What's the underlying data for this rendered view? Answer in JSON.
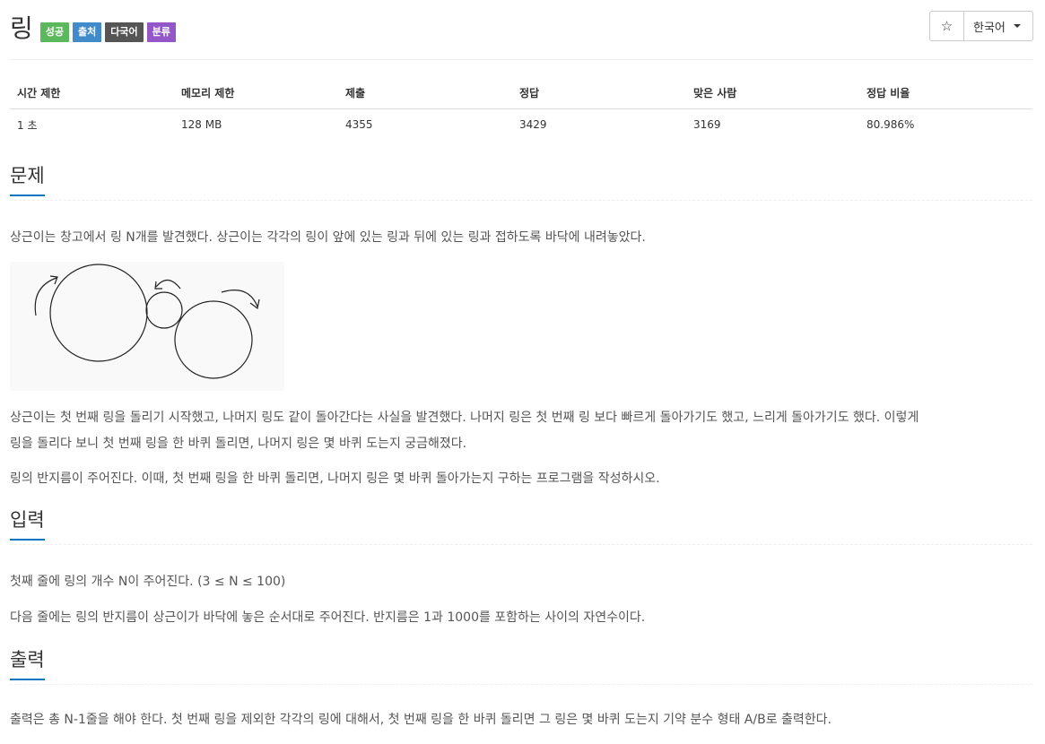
{
  "problem": {
    "title": "링",
    "badges": [
      {
        "label": "성공",
        "color": "#5cb85c"
      },
      {
        "label": "출처",
        "color": "#428bca"
      },
      {
        "label": "다국어",
        "color": "#555555"
      },
      {
        "label": "분류",
        "color": "#9457c9"
      }
    ]
  },
  "controls": {
    "star_icon": "star-outline-icon",
    "language": "한국어"
  },
  "info": {
    "headers": [
      "시간 제한",
      "메모리 제한",
      "제출",
      "정답",
      "맞은 사람",
      "정답 비율"
    ],
    "values": [
      "1 초",
      "128 MB",
      "4355",
      "3429",
      "3169",
      "80.986%"
    ]
  },
  "sections": {
    "description": {
      "heading": "문제",
      "p1": "상근이는 창고에서 링 N개를 발견했다. 상근이는 각각의 링이 앞에 있는 링과 뒤에 있는 링과 접하도록 바닥에 내려놓았다.",
      "p2a": "상근이는 첫 번째 링을 돌리기 시작했고, 나머지 링도 같이 돌아간다는 사실을 발견했다. 나머지 링은 첫 번째 링 보다 빠르게 돌아가기도 했고, 느리게 돌아가기도 했다. 이렇게",
      "p2b": "링을 돌리다 보니 첫 번째 링을 한 바퀴 돌리면, 나머지 링은 몇 바퀴 도는지 궁금해졌다.",
      "p3": "링의 반지름이 주어진다. 이때, 첫 번째 링을 한 바퀴 돌리면, 나머지 링은 몇 바퀴 돌아가는지 구하는 프로그램을 작성하시오."
    },
    "input": {
      "heading": "입력",
      "p1": "첫째 줄에 링의 개수 N이 주어진다. (3 ≤ N ≤ 100)",
      "p2": "다음 줄에는 링의 반지름이 상근이가 바닥에 놓은 순서대로 주어진다. 반지름은 1과 1000를 포함하는 사이의 자연수이다."
    },
    "output": {
      "heading": "출력",
      "p1": "출력은 총 N-1줄을 해야 한다. 첫 번째 링을 제외한 각각의 링에 대해서, 첫 번째 링을 한 바퀴 돌리면 그 링은 몇 바퀴 도는지 기약 분수 형태 A/B로 출력한다."
    }
  }
}
